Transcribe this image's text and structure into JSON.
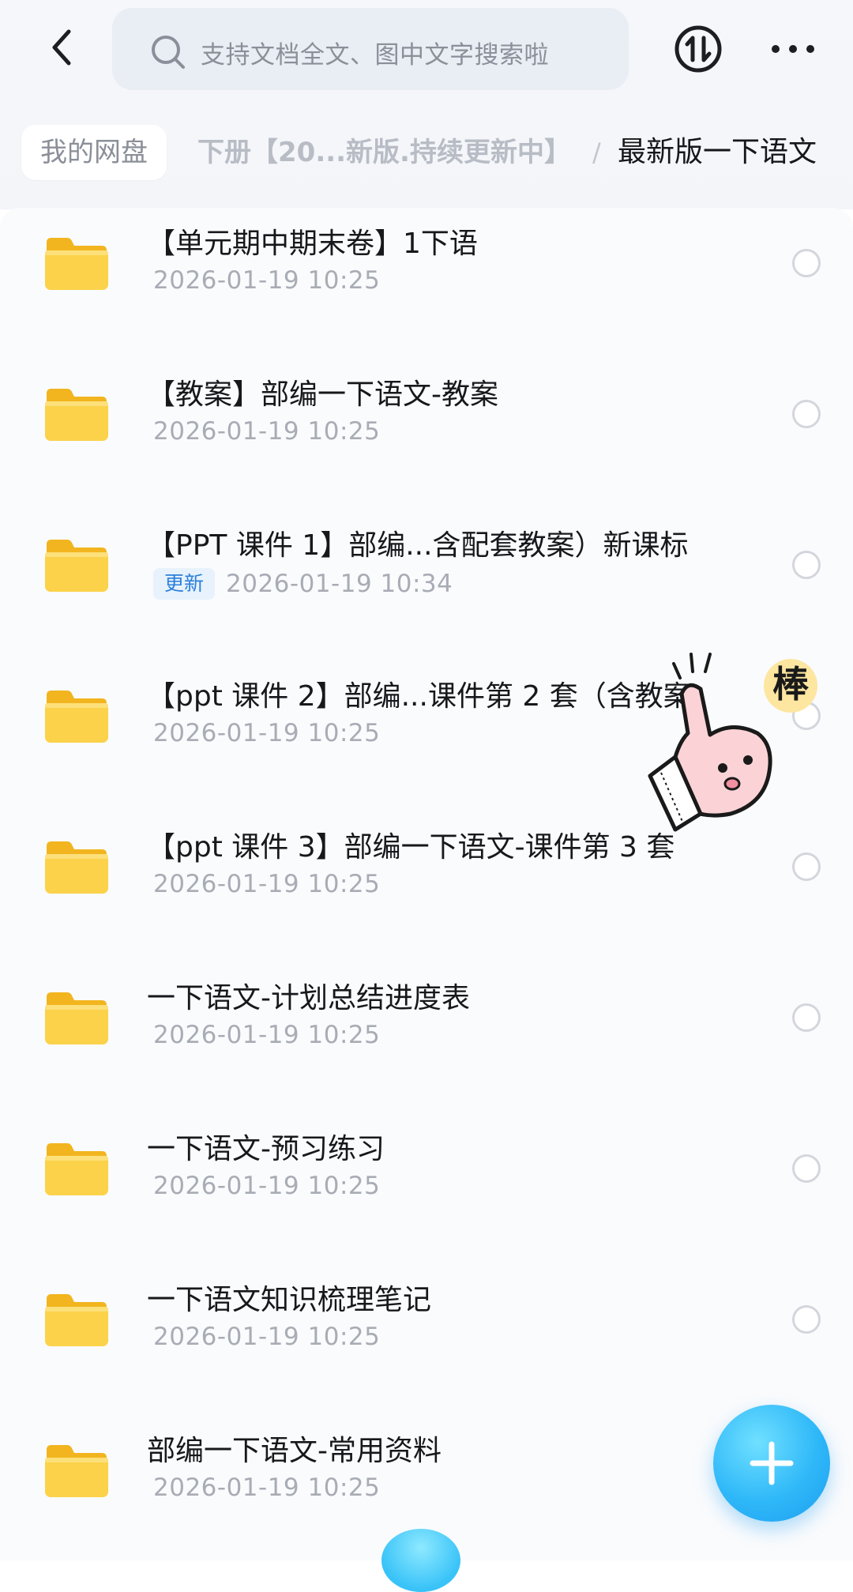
{
  "header": {
    "search_placeholder": "支持文档全文、图中文字搜索啦"
  },
  "breadcrumb": {
    "root": "我的网盘",
    "middle": "下册【20...新版.持续更新中】",
    "separator": "/",
    "current": "最新版一下语文"
  },
  "files": [
    {
      "title": "【单元期中期末卷】1下语",
      "date": "2026-01-19 10:25",
      "badge": ""
    },
    {
      "title": "【教案】部编一下语文-教案",
      "date": "2026-01-19 10:25",
      "badge": ""
    },
    {
      "title": "【PPT 课件 1】部编...含配套教案）新课标",
      "date": "2026-01-19 10:34",
      "badge": "更新"
    },
    {
      "title": "【ppt 课件 2】部编...课件第 2 套（含教案",
      "date": "2026-01-19 10:25",
      "badge": ""
    },
    {
      "title": "【ppt 课件 3】部编一下语文-课件第 3 套",
      "date": "2026-01-19 10:25",
      "badge": ""
    },
    {
      "title": "一下语文-计划总结进度表",
      "date": "2026-01-19 10:25",
      "badge": ""
    },
    {
      "title": "一下语文-预习练习",
      "date": "2026-01-19 10:25",
      "badge": ""
    },
    {
      "title": "一下语文知识梳理笔记",
      "date": "2026-01-19 10:25",
      "badge": ""
    },
    {
      "title": "部编一下语文-常用资料",
      "date": "2026-01-19 10:25",
      "badge": ""
    }
  ],
  "sticker": {
    "text": "棒"
  },
  "icons": {
    "back": "chevron-left-icon",
    "search": "search-icon",
    "transfer": "transfer-icon",
    "more": "more-icon",
    "folder": "folder-icon",
    "add": "plus-icon"
  },
  "colors": {
    "accent": "#2fb8f8",
    "folder": "#f8c93a",
    "badge_text": "#2b7fdc"
  }
}
